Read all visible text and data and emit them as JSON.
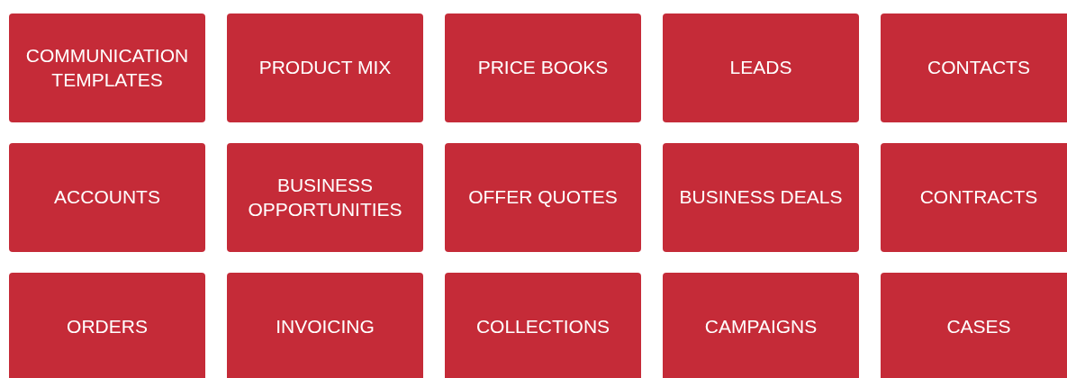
{
  "tiles": [
    {
      "label": "COMMUNICATION TEMPLATES"
    },
    {
      "label": "PRODUCT MIX"
    },
    {
      "label": "PRICE BOOKS"
    },
    {
      "label": "LEADS"
    },
    {
      "label": "CONTACTS"
    },
    {
      "label": "ACCOUNTS"
    },
    {
      "label": "BUSINESS OPPORTUNITIES"
    },
    {
      "label": "OFFER QUOTES"
    },
    {
      "label": "BUSINESS DEALS"
    },
    {
      "label": "CONTRACTS"
    },
    {
      "label": "ORDERS"
    },
    {
      "label": "INVOICING"
    },
    {
      "label": "COLLECTIONS"
    },
    {
      "label": "CAMPAIGNS"
    },
    {
      "label": "CASES"
    }
  ]
}
